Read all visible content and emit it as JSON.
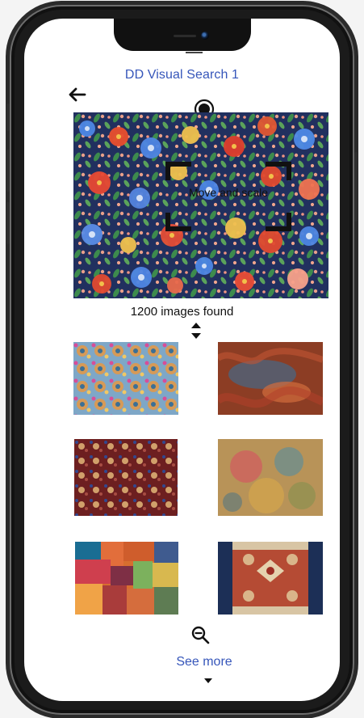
{
  "app": {
    "title": "DD Visual Search 1"
  },
  "search_area": {
    "selector_label": "Move and scale"
  },
  "results": {
    "count_text": "1200 images found"
  },
  "actions": {
    "see_more_label": "See more"
  },
  "icons": {
    "back": "back-arrow-icon",
    "capture": "capture-circle-icon",
    "sort": "sort-icon",
    "zoom_out": "zoom-out-icon",
    "expand": "chevron-down-icon"
  },
  "colors": {
    "accent": "#3656ba",
    "screen_bg": "#ffffff",
    "device_frame": "#111111"
  }
}
